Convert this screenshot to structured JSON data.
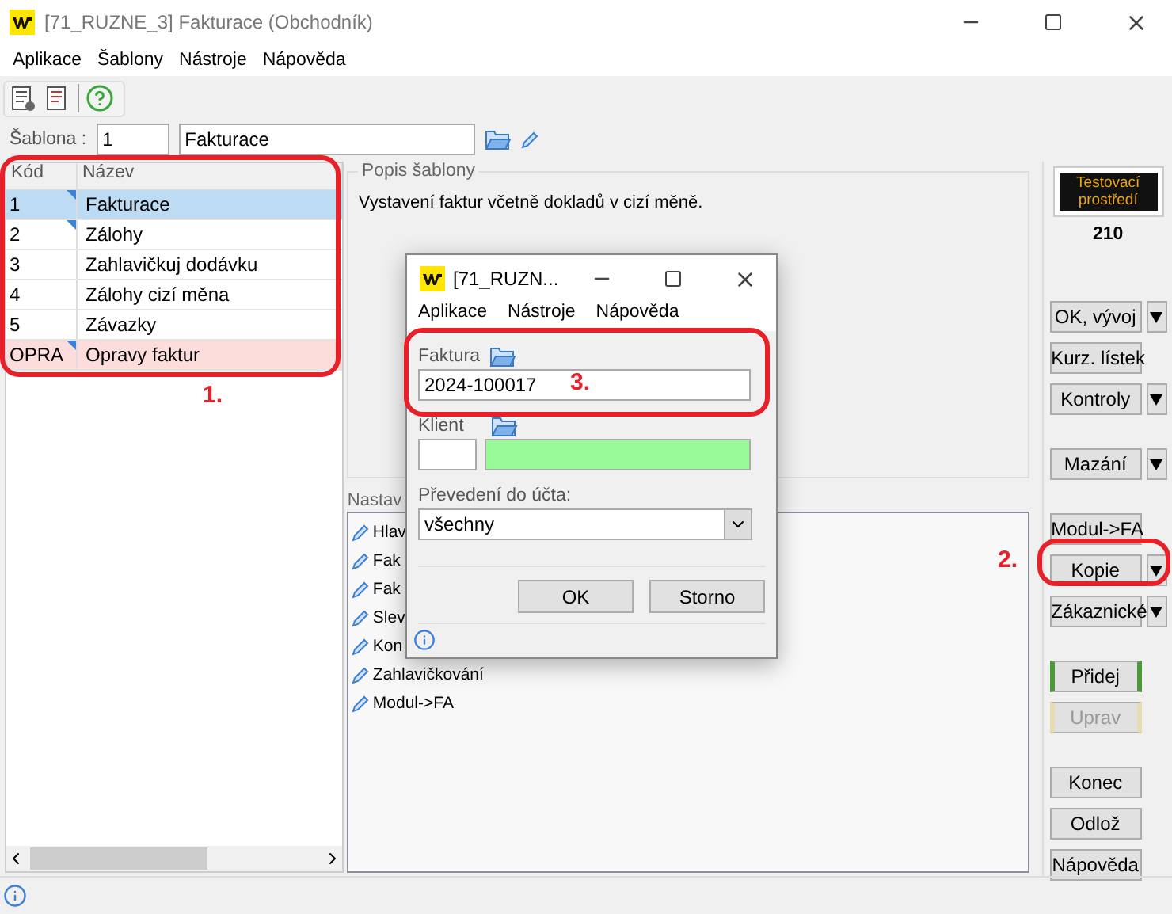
{
  "window": {
    "title": "[71_RUZNE_3] Fakturace (Obchodník)"
  },
  "menu": [
    "Aplikace",
    "Šablony",
    "Nástroje",
    "Nápověda"
  ],
  "template": {
    "label": "Šablona :",
    "code": "1",
    "name": "Fakturace"
  },
  "grid": {
    "columns": [
      "Kód",
      "Název"
    ],
    "rows": [
      {
        "code": "1",
        "name": "Fakturace",
        "selected": true,
        "flagged": true,
        "marked": false
      },
      {
        "code": "2",
        "name": "Zálohy",
        "selected": false,
        "flagged": true,
        "marked": false
      },
      {
        "code": "3",
        "name": "Zahlavičkuj dodávku",
        "selected": false,
        "flagged": false,
        "marked": false
      },
      {
        "code": "4",
        "name": "Zálohy cizí měna",
        "selected": false,
        "flagged": false,
        "marked": false
      },
      {
        "code": "5",
        "name": "Závazky",
        "selected": false,
        "flagged": false,
        "marked": false
      },
      {
        "code": "OPRA",
        "name": "Opravy faktur",
        "selected": false,
        "flagged": true,
        "marked": true
      }
    ]
  },
  "description": {
    "title": "Popis šablony",
    "text": "Vystavení faktur včetně dokladů v cizí měně."
  },
  "settings": {
    "title": "Nastav",
    "items": [
      "Hlav",
      "Fak",
      "Fak",
      "Slev",
      "Kon",
      "Zahlavičkování",
      "Modul->FA"
    ]
  },
  "environment": {
    "badge": "Testovací prostředí",
    "number": "210"
  },
  "button_groups": [
    [
      {
        "label": "OK, vývoj",
        "dropdown": true,
        "kind": "plain",
        "disabled": false
      },
      {
        "label": "Kurz. lístek",
        "dropdown": false,
        "kind": "plain",
        "disabled": false
      },
      {
        "label": "Kontroly",
        "dropdown": true,
        "kind": "plain",
        "disabled": false
      }
    ],
    [
      {
        "label": "Mazání",
        "dropdown": true,
        "kind": "plain",
        "disabled": false
      }
    ],
    [
      {
        "label": "Modul->FA",
        "dropdown": false,
        "kind": "plain",
        "disabled": false
      },
      {
        "label": "Kopie",
        "dropdown": true,
        "kind": "plain",
        "disabled": false
      },
      {
        "label": "Zákaznické",
        "dropdown": true,
        "kind": "plain",
        "disabled": false
      }
    ],
    [
      {
        "label": "Přidej",
        "dropdown": false,
        "kind": "accent",
        "disabled": false
      },
      {
        "label": "Uprav",
        "dropdown": false,
        "kind": "accent",
        "disabled": true
      }
    ],
    [
      {
        "label": "Konec",
        "dropdown": false,
        "kind": "plain",
        "disabled": false
      },
      {
        "label": "Odlož",
        "dropdown": false,
        "kind": "plain",
        "disabled": false
      },
      {
        "label": "Nápověda",
        "dropdown": false,
        "kind": "plain",
        "disabled": false
      }
    ]
  ],
  "dialog": {
    "title": "[71_RUZN...",
    "menu": [
      "Aplikace",
      "Nástroje",
      "Nápověda"
    ],
    "invoice": {
      "label": "Faktura",
      "value": "2024-100017"
    },
    "client": {
      "label": "Klient"
    },
    "transfer": {
      "label": "Převedení do účta:",
      "value": "všechny"
    },
    "buttons": [
      "OK",
      "Storno"
    ]
  },
  "annotations": [
    "1.",
    "2.",
    "3."
  ]
}
